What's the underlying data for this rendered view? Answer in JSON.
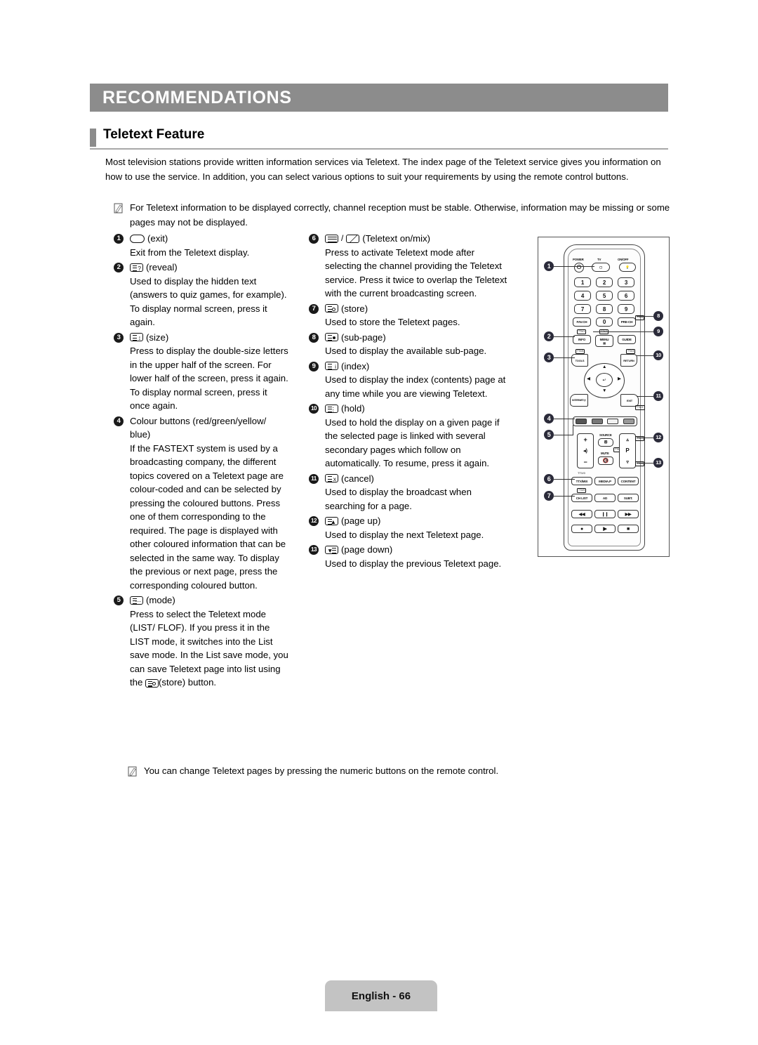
{
  "banner": {
    "title": "RECOMMENDATIONS"
  },
  "section": {
    "title": "Teletext Feature"
  },
  "intro": "Most television stations provide written information services via Teletext. The index page of the Teletext service gives you information on how to use the service. In addition, you can select various options to suit your requirements by using the remote control buttons.",
  "note_top": "For Teletext information to be displayed correctly, channel reception must be stable. Otherwise, information may be missing or some pages may not be displayed.",
  "note_bottom": "You can change Teletext pages by pressing the numeric buttons on the remote control.",
  "items": [
    {
      "num": "1",
      "icon": "exit-button-icon",
      "label": "(exit)",
      "body": "Exit from the Teletext display."
    },
    {
      "num": "2",
      "icon": "reveal-button-icon",
      "label": "(reveal)",
      "body": "Used to display the hidden text (answers to quiz games, for example). To display normal screen, press it again."
    },
    {
      "num": "3",
      "icon": "size-button-icon",
      "label": "(size)",
      "body": "Press to display the double-size letters in the upper half of the screen. For lower half of the screen, press it again. To display normal screen, press it once again."
    },
    {
      "num": "4",
      "icon": "colour-buttons-icon",
      "label": "Colour buttons (red/green/yellow/ blue)",
      "body": "If the FASTEXT system is used by a broadcasting company, the different topics covered on a Teletext page are colour-coded and can be selected by pressing the coloured buttons. Press one of them corresponding to the required. The page is displayed with other coloured information that can be selected in the same way. To display the previous or next page, press the corresponding coloured button."
    },
    {
      "num": "5",
      "icon": "mode-button-icon",
      "label": "(mode)",
      "body_part1": "Press to select the Teletext mode (LIST/ FLOF). If you press it in the LIST mode, it switches into the List save mode. In the List save mode, you can save Teletext page into list using the ",
      "body_part2": "(store) button."
    },
    {
      "num": "6",
      "icon": "teletext-on-mix-button-icon",
      "label": "(Teletext on/mix)",
      "body": "Press to activate Teletext mode after selecting the channel providing the Teletext service. Press it twice to overlap the Teletext with the current broadcasting screen."
    },
    {
      "num": "7",
      "icon": "store-button-icon",
      "label": "(store)",
      "body": "Used to store the Teletext pages."
    },
    {
      "num": "8",
      "icon": "sub-page-button-icon",
      "label": "(sub-page)",
      "body": "Used to display the available sub-page."
    },
    {
      "num": "9",
      "icon": "index-button-icon",
      "label": "(index)",
      "body": "Used to display the index (contents) page at any time while you are viewing Teletext."
    },
    {
      "num": "10",
      "icon": "hold-button-icon",
      "label": "(hold)",
      "body": "Used to hold the display on a given page if the selected page is linked with several secondary pages which follow on automatically. To resume, press it again."
    },
    {
      "num": "11",
      "icon": "cancel-button-icon",
      "label": "(cancel)",
      "body": "Used to display the broadcast when searching for a page."
    },
    {
      "num": "12",
      "icon": "page-up-button-icon",
      "label": "(page up)",
      "body": "Used to display the next Teletext page."
    },
    {
      "num": "13",
      "icon": "page-down-button-icon",
      "label": "(page down)",
      "body": "Used to display the previous Teletext page."
    }
  ],
  "remote": {
    "power_label": "POWER",
    "tv_label": "TV",
    "onoff_label": "ON/OFF",
    "numbers": [
      "1",
      "2",
      "3",
      "4",
      "5",
      "6",
      "7",
      "8",
      "9"
    ],
    "fav_ch": "FAV.CH",
    "zero": "0",
    "pre_ch": "PRE-CH",
    "info": "INFO",
    "menu": "MENU",
    "guide": "GUIDE",
    "tools": "TOOLS",
    "return": "RETURN",
    "internet": "INTERNET@",
    "exit": "EXIT",
    "source": "SOURCE",
    "mute": "MUTE",
    "p_label": "P",
    "ttx_mix": "TTX/MIX",
    "media_p": "MEDIA.P",
    "content": "CONTENT",
    "ch_list": "CH LIST",
    "ad": "AD",
    "subt": "SUBT.",
    "mini_info": "TTX/1",
    "mini_menu": "TTX/2",
    "mini_tools": "TTX/5",
    "mini_return": "TTX/3",
    "mini_exit": "TTX/X",
    "mini_prech": "TTX/6",
    "mini_ttx": "TTX/0",
    "mini_chlist": "TTX/9",
    "mini_pup": "TTX/7",
    "mini_pdown": "TTX/8",
    "mini_source": "TTX/4",
    "callouts": [
      "1",
      "2",
      "3",
      "4",
      "5",
      "6",
      "7",
      "8",
      "9",
      "10",
      "11",
      "12",
      "13"
    ],
    "colour_swatches": [
      "#555555",
      "#777777",
      "#f0f0f0",
      "#999999"
    ]
  },
  "footer": {
    "text": "English - 66"
  }
}
